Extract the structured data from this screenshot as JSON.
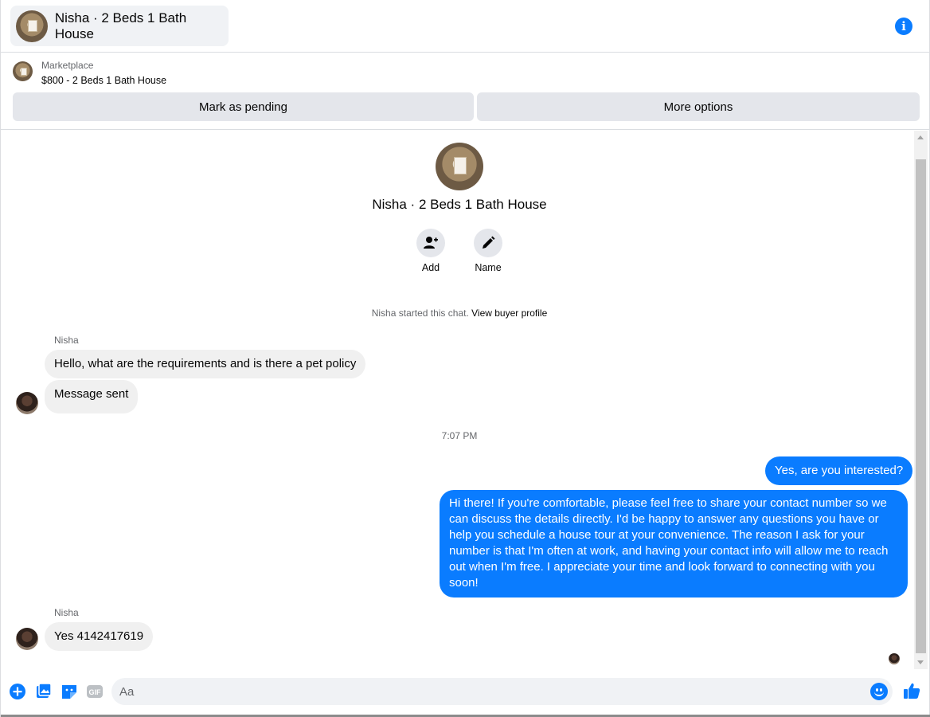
{
  "header": {
    "title": "Nisha · 2 Beds 1 Bath House"
  },
  "marketplace": {
    "label": "Marketplace",
    "listing": "$800 - 2 Beds 1 Bath House",
    "mark_pending": "Mark as pending",
    "more_options": "More options"
  },
  "profile": {
    "name": "Nisha · 2 Beds 1 Bath House",
    "add_label": "Add",
    "name_label": "Name"
  },
  "chat_start": {
    "text": "Nisha started this chat. ",
    "link": "View buyer profile"
  },
  "messages": [
    {
      "sender": "Nisha",
      "text": "Hello, what are the requirements and is there a pet policy"
    },
    {
      "text": "Message sent"
    },
    {
      "timestamp": "7:07 PM"
    },
    {
      "text": "Yes, are you interested?"
    },
    {
      "text": "Hi there! If you're comfortable, please feel free to share your contact number so we can discuss the details directly. I'd be happy to answer any questions you have or help you schedule a house tour at your convenience. The reason I ask for your number is that I'm often at work, and having your contact info will allow me to reach out when I'm free. I appreciate your time and look forward to connecting with you soon!"
    },
    {
      "sender": "Nisha",
      "text": "Yes 4142417619"
    }
  ],
  "composer": {
    "placeholder": "Aa"
  },
  "colors": {
    "accent": "#0a7cff",
    "incoming_bubble": "#f0f0f0",
    "button_bg": "#e4e6eb"
  },
  "icons": [
    "info-icon",
    "add-person-icon",
    "pencil-icon",
    "plus-icon",
    "image-icon",
    "sticker-icon",
    "gif-icon",
    "emoji-icon",
    "thumbs-up-icon"
  ]
}
